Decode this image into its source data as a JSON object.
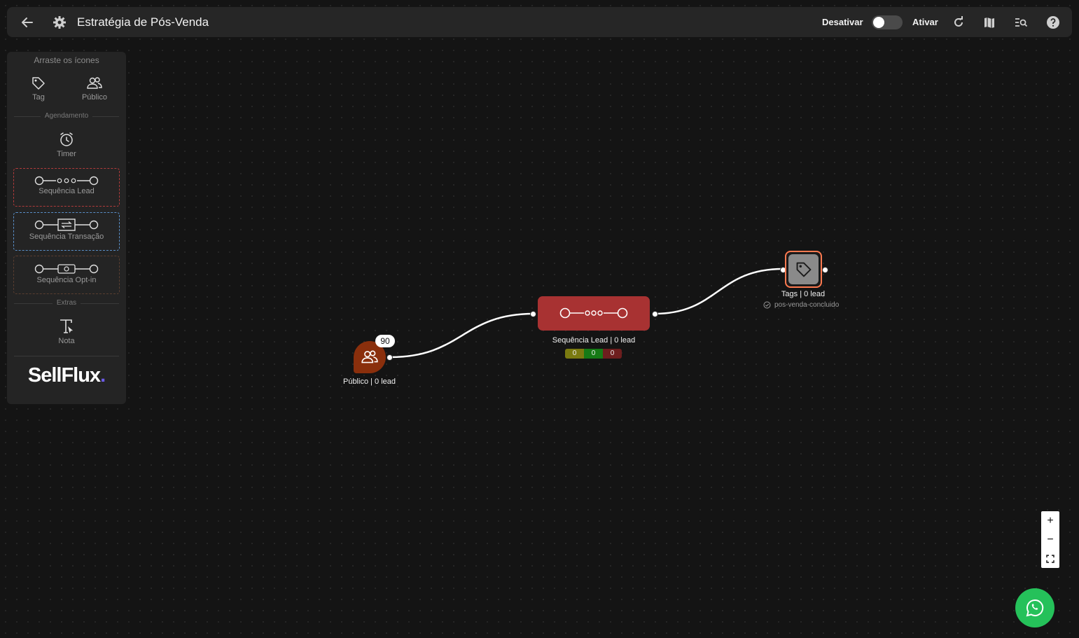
{
  "header": {
    "title": "Estratégia de Pós-Venda",
    "deactivate_label": "Desativar",
    "activate_label": "Ativar",
    "toggle_state": "off"
  },
  "palette": {
    "hint": "Arraste os ícones",
    "items": [
      {
        "label": "Tag",
        "icon": "tag-icon"
      },
      {
        "label": "Público",
        "icon": "audience-icon"
      }
    ],
    "section_scheduling": "Agendamento",
    "timer_label": "Timer",
    "sequences": [
      {
        "label": "Sequência Lead",
        "icon": "lead-sequence-icon",
        "border_color": "#b23b3b"
      },
      {
        "label": "Sequência Transação",
        "icon": "transaction-sequence-icon",
        "border_color": "#5a8fc8"
      },
      {
        "label": "Sequência Opt-in",
        "icon": "optin-sequence-icon",
        "border_color": "#6a4b3a"
      }
    ],
    "section_extras": "Extras",
    "note_label": "Nota",
    "logo_text": "SellFlux",
    "logo_dot": "."
  },
  "nodes": {
    "publico": {
      "label": "Público | 0 lead",
      "badge": "90",
      "color": "#8a2f0c"
    },
    "sequencia": {
      "label": "Sequência Lead | 0 lead",
      "color": "#a83232",
      "stats": [
        "0",
        "0",
        "0"
      ],
      "stat_colors": [
        "#7a7a10",
        "#167a16",
        "#6e1e1e"
      ]
    },
    "tags": {
      "label": "Tags | 0 lead",
      "tag_name": "pos-venda-concluido",
      "border_color": "#ff7a50"
    }
  },
  "zoom": {
    "in": "+",
    "out": "−"
  },
  "accent_colors": {
    "whatsapp": "#25c15a"
  }
}
